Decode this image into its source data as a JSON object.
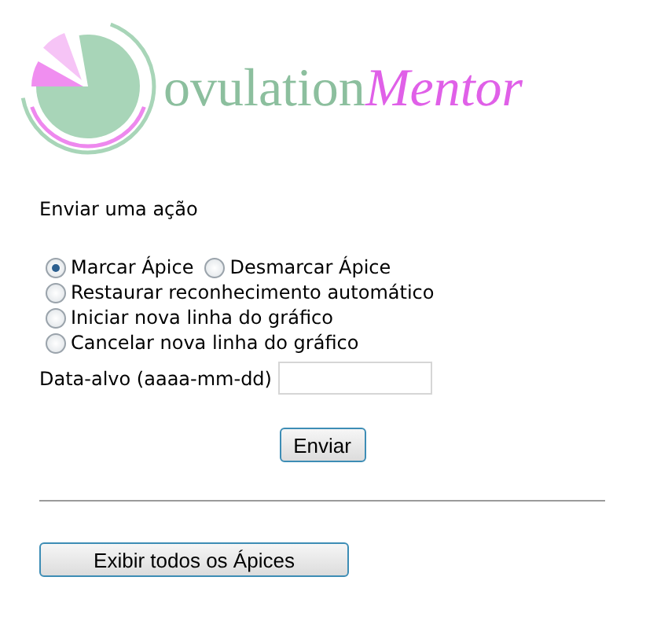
{
  "logo": {
    "first": "ovulation",
    "second": "Mentor"
  },
  "form": {
    "title": "Enviar uma ação",
    "radio_rows": [
      {
        "options": [
          {
            "label": "Marcar Ápice",
            "selected": true
          },
          {
            "label": "Desmarcar Ápice",
            "selected": false
          },
          {
            "label": "Restaurar reconhecimento automático",
            "selected": false
          }
        ]
      },
      {
        "options": [
          {
            "label": "Iniciar nova linha do gráfico",
            "selected": false
          },
          {
            "label": "Cancelar nova linha do gráfico",
            "selected": false
          }
        ]
      }
    ],
    "date_label": "Data-alvo (aaaa-mm-dd)",
    "submit": "Enviar"
  },
  "show_all_button": "Exibir todos os Ápices"
}
